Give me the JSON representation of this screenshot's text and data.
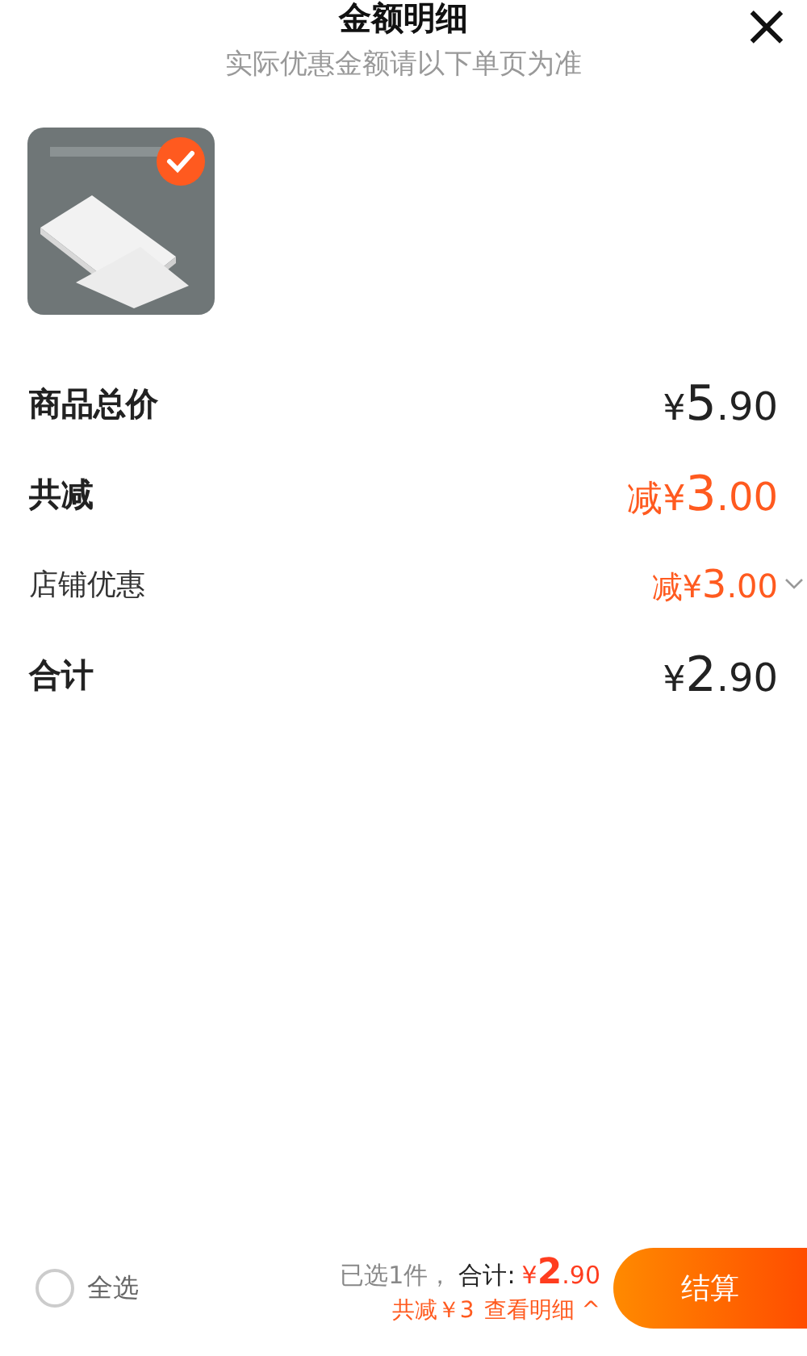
{
  "header": {
    "title": "金额明细",
    "subtitle": "实际优惠金额请以下单页为准",
    "close": "×"
  },
  "product": {
    "selected": true
  },
  "rows": [
    {
      "label": "商品总价",
      "prefix": "¥",
      "whole": "5",
      "fraction": ".90",
      "kind": "main",
      "discount": false,
      "expandable": false
    },
    {
      "label": "共减",
      "prefix": "减¥",
      "whole": "3",
      "fraction": ".00",
      "kind": "main",
      "discount": true,
      "expandable": false
    },
    {
      "label": "店铺优惠",
      "prefix": "减¥",
      "whole": "3",
      "fraction": ".00",
      "kind": "sub",
      "discount": true,
      "expandable": true
    },
    {
      "label": "合计",
      "prefix": "¥",
      "whole": "2",
      "fraction": ".90",
      "kind": "main",
      "discount": false,
      "expandable": false
    }
  ],
  "footer": {
    "select_all": {
      "label": "全选",
      "checked": false
    },
    "count": "已选1件，",
    "total_label": "合计:",
    "total_prefix": "¥",
    "total_whole": "2",
    "total_fraction": ".90",
    "saving": "共减￥3",
    "details": "查看明细 ^",
    "checkout": "结算"
  }
}
